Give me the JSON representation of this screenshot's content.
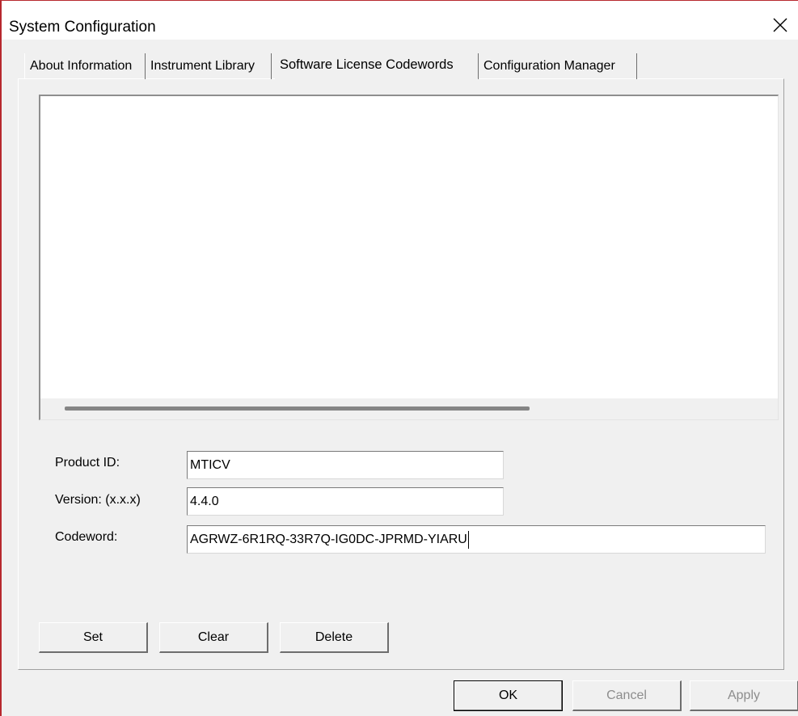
{
  "window": {
    "title": "System Configuration"
  },
  "tabs": [
    {
      "label": "About Information",
      "active": false
    },
    {
      "label": "Instrument Library",
      "active": false
    },
    {
      "label": "Software License Codewords",
      "active": true
    },
    {
      "label": "Configuration Manager",
      "active": false
    }
  ],
  "form": {
    "product_id_label": "Product ID:",
    "product_id_value": "MTICV",
    "version_label": "Version: (x.x.x)",
    "version_value": "4.4.0",
    "codeword_label": "Codeword:",
    "codeword_value": "AGRWZ-6R1RQ-33R7Q-IG0DC-JPRMD-YIARU"
  },
  "actions": {
    "set_label": "Set",
    "clear_label": "Clear",
    "delete_label": "Delete"
  },
  "footer": {
    "ok_label": "OK",
    "cancel_label": "Cancel",
    "apply_label": "Apply"
  },
  "colors": {
    "window_bg": "#f0f0f0",
    "accent_border": "#b7282e",
    "disabled_text": "#8d8d8d"
  },
  "icons": {
    "close": "close-icon"
  }
}
